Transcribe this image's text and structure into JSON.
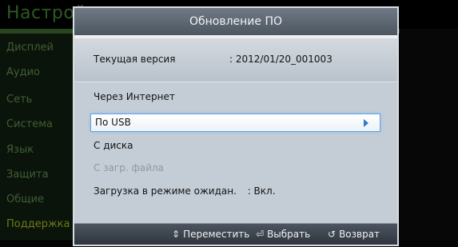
{
  "background_menu": {
    "title": "Настрой",
    "items": [
      "Дисплей",
      "Аудио",
      "Сеть",
      "Система",
      "Язык",
      "Защита",
      "Общие",
      "Поддержка"
    ]
  },
  "dialog": {
    "title": "Обновление ПО",
    "current_version_label": "Текущая версия",
    "current_version_value": ":  2012/01/20_001003",
    "options": {
      "internet": "Через Интернет",
      "usb": "По USB",
      "disc": "С диска",
      "file": "С загр. файла",
      "standby_label": "Загрузка в режиме ожидан.",
      "standby_value": ":  Вкл."
    },
    "footer": {
      "move": "Переместить",
      "select": "Выбрать",
      "return": "Возврат"
    }
  },
  "colors": {
    "selection_border": "#5fa5e6",
    "arrow": "#2f78d6",
    "active_menu": "#6e7a18"
  }
}
